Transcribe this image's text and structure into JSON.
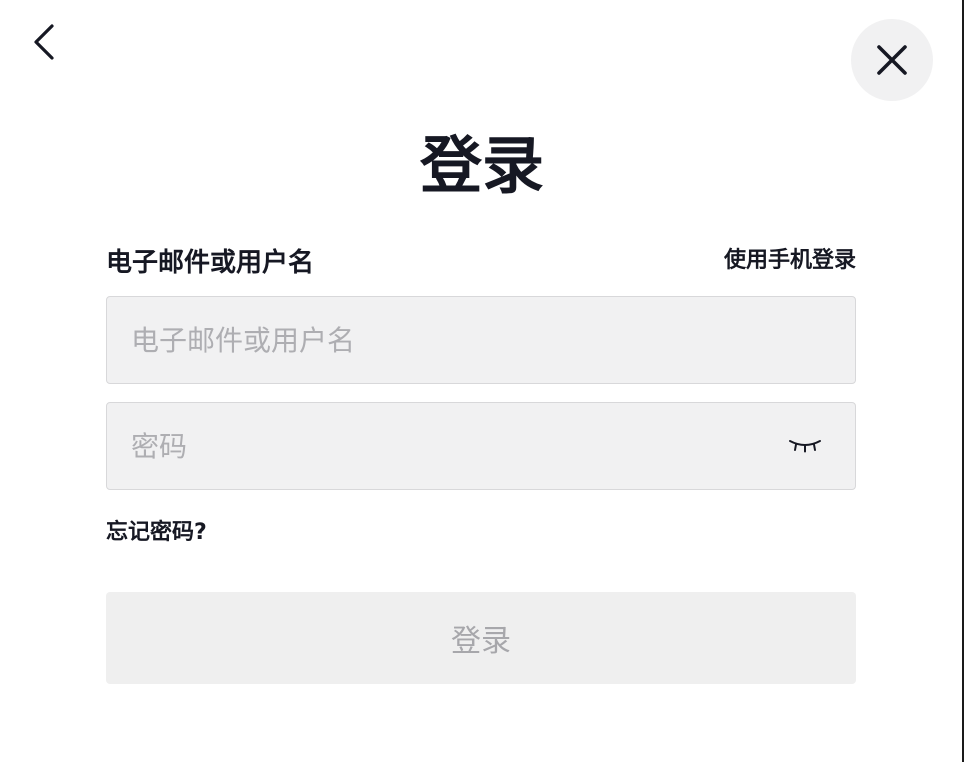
{
  "header": {
    "back_icon": "chevron-left-icon",
    "close_icon": "close-icon",
    "title": "登录"
  },
  "form": {
    "email_label": "电子邮件或用户名",
    "phone_login_link": "使用手机登录",
    "email_input": {
      "value": "",
      "placeholder": "电子邮件或用户名"
    },
    "password_input": {
      "value": "",
      "placeholder": "密码",
      "toggle_icon": "eye-closed-icon"
    },
    "forgot_password_link": "忘记密码?",
    "submit_label": "登录"
  },
  "colors": {
    "background": "#ffffff",
    "text": "#161823",
    "input_background": "#f1f1f2",
    "placeholder": "#aeaeb2",
    "button_disabled_background": "#efefef",
    "button_disabled_text": "#a7a7ab"
  }
}
